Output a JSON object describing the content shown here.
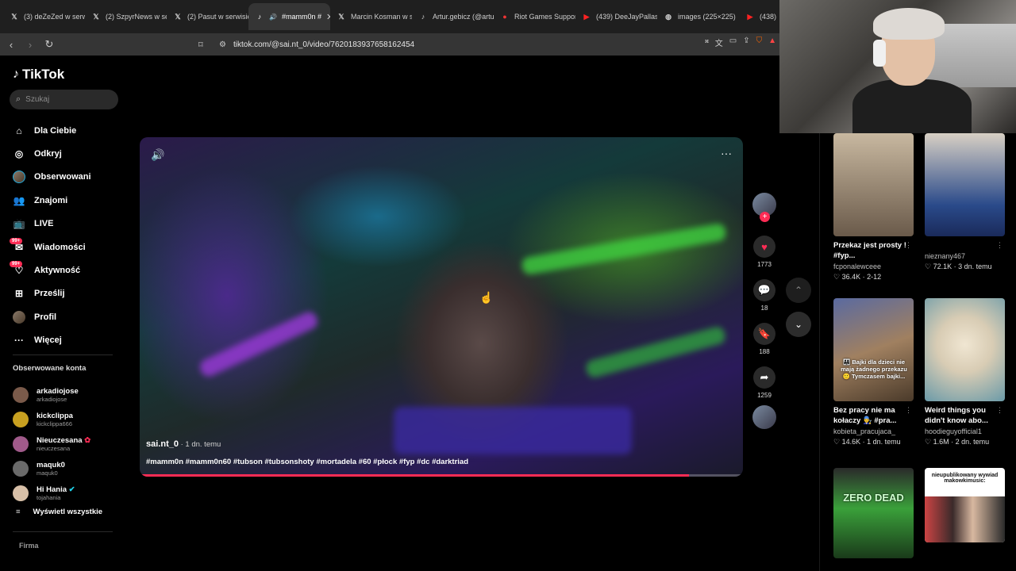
{
  "browser": {
    "tabs": [
      {
        "icon": "x-icon",
        "label": "(3) deZeZed w serw"
      },
      {
        "icon": "x-icon",
        "label": "(2) SzpyrNews w se"
      },
      {
        "icon": "x-icon",
        "label": "(2) Pasut w serwisie"
      },
      {
        "icon": "tiktok-icon",
        "label": "#mamm0n #"
      },
      {
        "icon": "x-icon",
        "label": "Marcin Kosman w se"
      },
      {
        "icon": "tiktok-icon",
        "label": "Artur.gebicz (@artu"
      },
      {
        "icon": "riot-icon",
        "label": "Riot Games Support"
      },
      {
        "icon": "youtube-icon",
        "label": "(439) DeeJayPallasi"
      },
      {
        "icon": "globe-icon",
        "label": "images (225×225)"
      },
      {
        "icon": "youtube-icon",
        "label": "(438) M"
      }
    ],
    "url": "tiktok.com/@sai.nt_0/video/7620183937658162454"
  },
  "sidebar": {
    "logo": "TikTok",
    "search_placeholder": "Szukaj",
    "menu": [
      {
        "label": "Dla Ciebie",
        "icon": "home-icon",
        "badge": ""
      },
      {
        "label": "Odkryj",
        "icon": "compass-icon",
        "badge": ""
      },
      {
        "label": "Obserwowani",
        "icon": "avatar",
        "badge": ""
      },
      {
        "label": "Znajomi",
        "icon": "friends-icon",
        "badge": ""
      },
      {
        "label": "LIVE",
        "icon": "live-icon",
        "badge": ""
      },
      {
        "label": "Wiadomości",
        "icon": "message-icon",
        "badge": "99+"
      },
      {
        "label": "Aktywność",
        "icon": "activity-icon",
        "badge": "99+"
      },
      {
        "label": "Prześlij",
        "icon": "upload-icon",
        "badge": ""
      },
      {
        "label": "Profil",
        "icon": "avatar",
        "badge": ""
      },
      {
        "label": "Więcej",
        "icon": "more-icon",
        "badge": ""
      }
    ],
    "followed_title": "Obserwowane konta",
    "followed": [
      {
        "name": "arkadiojose",
        "user": "arkadiojose",
        "color": "#7a5a4a",
        "verified": false,
        "live": false
      },
      {
        "name": "kickclippa",
        "user": "kickclippa666",
        "color": "#c8a020",
        "verified": false,
        "live": false
      },
      {
        "name": "Nieuczesana",
        "user": "nieuczesana",
        "color": "#a05a8a",
        "verified": false,
        "live": true
      },
      {
        "name": "maquk0",
        "user": "maquk0",
        "color": "#6a6a6a",
        "verified": false,
        "live": false
      },
      {
        "name": "Hi Hania",
        "user": "tojahania",
        "color": "#d8c0a8",
        "verified": true,
        "live": false
      }
    ],
    "show_all": "Wyświetl wszystkie",
    "footer": "Firma"
  },
  "video": {
    "author": "sai.nt_0",
    "date": " · 1 dn. temu",
    "tags": "#mamm0n #mamm0n60 #tubson #tubsonshoty #mortadela #60 #płock #fyp #dc #darktriad",
    "progress": 0.91
  },
  "actions": {
    "likes": "1773",
    "comments": "18",
    "saves": "188",
    "shares": "1259"
  },
  "recommendations": [
    {
      "title": "Przekaz jest prosty ! #fyp...",
      "user": "fcponalewceee",
      "likes": "36.4K",
      "date": "2-12",
      "thumb_text": ""
    },
    {
      "title": "",
      "user": "nieznany467",
      "likes": "72.1K",
      "date": "3 dn. temu",
      "thumb_text": ""
    },
    {
      "title": "Bez pracy nie ma kołaczy 👨‍🔧 #pra...",
      "user": "kobieta_pracujaca_",
      "likes": "14.6K",
      "date": "1 dn. temu",
      "thumb_text": "👨‍👩‍👧 Bajki dla dzieci nie mają żadnego przekazu 🙂 Tymczasem bajki..."
    },
    {
      "title": "Weird things you didn't know abo...",
      "user": "hoodieguyofficial1",
      "likes": "1.6M",
      "date": "2 dn. temu",
      "thumb_text": ""
    },
    {
      "title": "",
      "user": "",
      "likes": "",
      "date": "",
      "thumb_text": "ZERO DEAD"
    },
    {
      "title": "",
      "user": "",
      "likes": "",
      "date": "",
      "thumb_text": "nieupublikowany wywiad makowkimusic:"
    }
  ]
}
